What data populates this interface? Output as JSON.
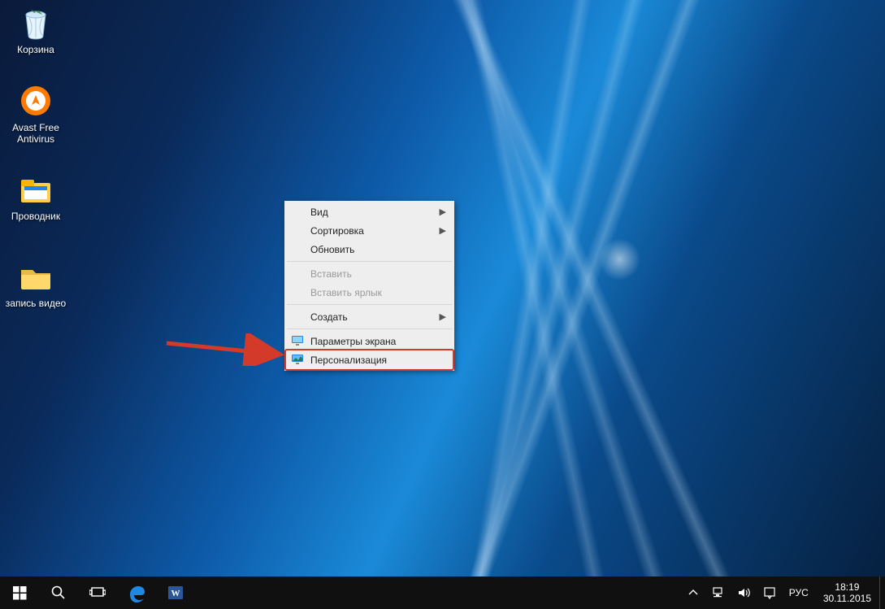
{
  "desktop_icons": {
    "recycle_bin": "Корзина",
    "avast": "Avast Free Antivirus",
    "explorer": "Проводник",
    "record": "запись видео"
  },
  "context_menu": {
    "view": "Вид",
    "sort": "Сортировка",
    "refresh": "Обновить",
    "paste": "Вставить",
    "paste_shortcut": "Вставить ярлык",
    "create": "Создать",
    "display_settings": "Параметры экрана",
    "personalize": "Персонализация"
  },
  "tray": {
    "lang": "РУС",
    "time": "18:19",
    "date": "30.11.2015"
  }
}
